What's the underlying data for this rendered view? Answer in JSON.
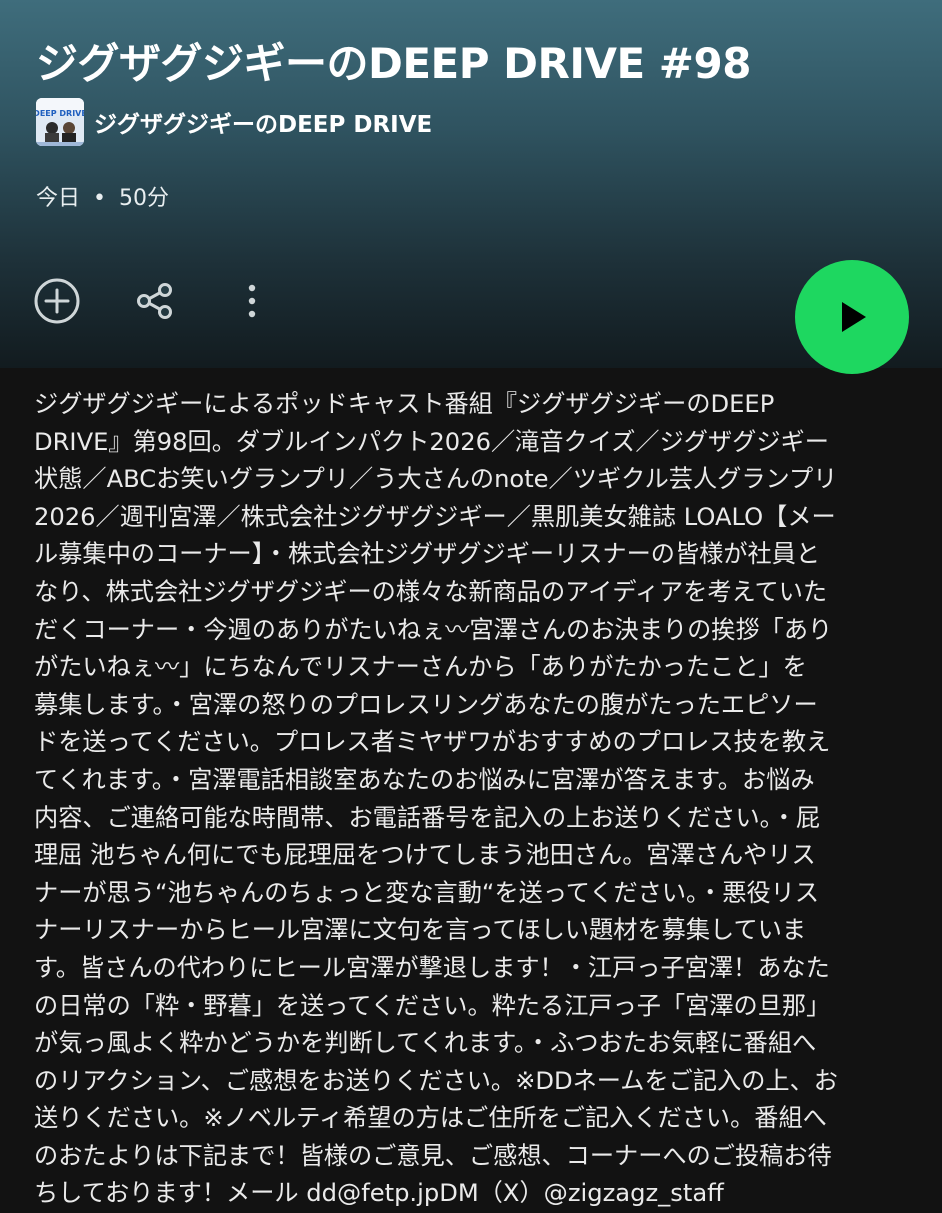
{
  "episode": {
    "title": "ジグザグジギーのDEEP DRIVE #98",
    "show_name": "ジグザグジギーのDEEP DRIVE",
    "thumbnail_text": "DEEP DRIVE",
    "date": "今日",
    "separator": "•",
    "duration": "50分"
  },
  "actions": {
    "add_icon": "plus-circle-icon",
    "share_icon": "share-icon",
    "more_icon": "more-vertical-icon",
    "play_icon": "play-icon"
  },
  "colors": {
    "accent": "#1ed760",
    "background": "#121212",
    "header_gradient_top": "#3f6d7c"
  },
  "description": "ジグザグジギーによるポッドキャスト番組『ジグザグジギーのDEEP\nDRIVE』第98回。ダブルインパクト2026／滝音クイズ／ジグザグジギー\n状態／ABCお笑いグランプリ／う大さんのnote／ツギクル芸人グランプリ\n2026／週刊宮澤／株式会社ジグザグジギー／黒肌美女雑誌 LOALO【メー\nル募集中のコーナー】・株式会社ジグザグジギーリスナーの皆様が社員と\nなり、株式会社ジグザグジギーの様々な新商品のアイディアを考えていた\nだくコーナー・今週のありがたいねぇ〰宮澤さんのお決まりの挨拶「あり\nがたいねぇ〰」にちなんでリスナーさんから「ありがたかったこと」を\n募集します。・宮澤の怒りのプロレスリングあなたの腹がたったエピソー\nドを送ってください。プロレス者ミヤザワがおすすめのプロレス技を教え\nてくれます。・宮澤電話相談室あなたのお悩みに宮澤が答えます。お悩み\n内容、ご連絡可能な時間帯、お電話番号を記入の上お送りください。・屁\n理屈 池ちゃん何にでも屁理屈をつけてしまう池田さん。宮澤さんやリス\nナーが思う“池ちゃんのちょっと変な言動“を送ってください。・悪役リス\nナーリスナーからヒール宮澤に文句を言ってほしい題材を募集していま\nす。皆さんの代わりにヒール宮澤が撃退します！・江戸っ子宮澤！あなた\nの日常の「粋・野暮」を送ってください。粋たる江戸っ子「宮澤の旦那」\nが気っ風よく粋かどうかを判断してくれます。・ふつおたお気軽に番組へ\nのリアクション、ご感想をお送りください。※DDネームをご記入の上、お\n送りください。※ノベルティ希望の方はご住所をご記入ください。番組へ\nのおたよりは下記まで！皆様のご意見、ご感想、コーナーへのご投稿お待\nちしております！メール dd@fetp.jpDM（X）@zigzagz_staff"
}
